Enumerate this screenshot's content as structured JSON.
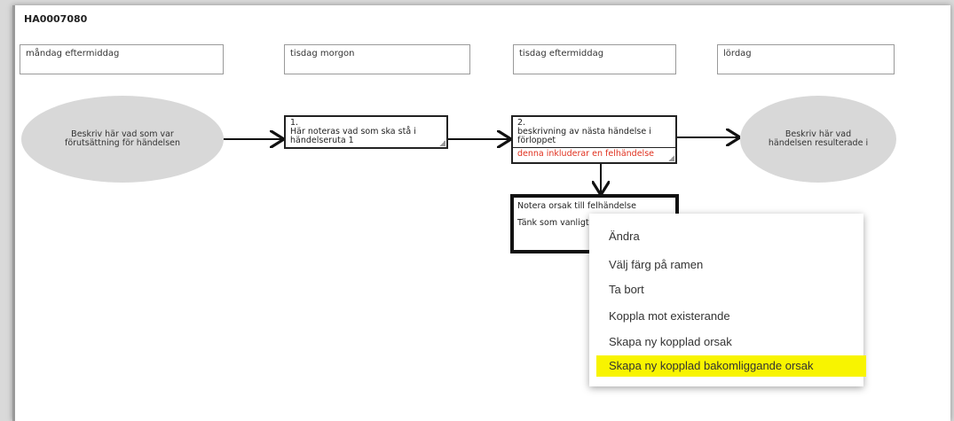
{
  "case_id": "HA0007080",
  "time_labels": [
    "måndag eftermiddag",
    "tisdag morgon",
    "tisdag eftermiddag",
    "lördag"
  ],
  "start_ellipse": "Beskriv här vad som var förutsättning för händelsen",
  "end_ellipse": "Beskriv här vad händelsen resulterade i",
  "event1": {
    "number": "1.",
    "text": "Här noteras vad som ska stå i händelseruta 1"
  },
  "event2": {
    "number": "2.",
    "text": "beskrivning av nästa händelse i förloppet",
    "note": "denna inkluderar en felhändelse"
  },
  "cause": {
    "title": "Notera orsak till felhändelse",
    "text": "Tänk som vanligt t..."
  },
  "context_menu": {
    "items": [
      "Ändra",
      "Välj färg på ramen",
      "Ta bort",
      "Koppla mot existerande",
      "Skapa ny kopplad orsak",
      "Skapa ny kopplad bakomliggande orsak"
    ],
    "highlighted_color": "#f8f400"
  }
}
